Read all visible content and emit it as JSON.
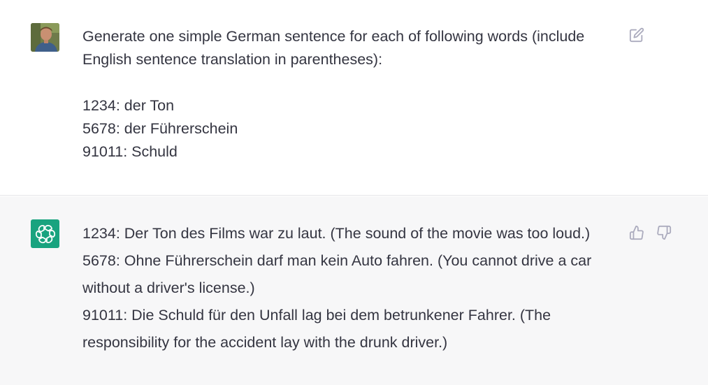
{
  "conversation": {
    "user_message": {
      "avatar_icon": "user-photo-avatar",
      "intro_lines": [
        "Generate one simple German sentence for each of following words (include",
        "English sentence translation in parentheses):"
      ],
      "word_lines": [
        "1234: der Ton",
        "5678: der Führerschein",
        "91011: Schuld"
      ],
      "edit_icon": "edit-icon"
    },
    "assistant_message": {
      "avatar_icon": "openai-logo-icon",
      "avatar_color": "#19a37f",
      "lines": [
        "1234: Der Ton des Films war zu laut. (The sound of the movie was too loud.)",
        "5678: Ohne Führerschein darf man kein Auto fahren. (You cannot drive a car",
        "without a driver's license.)",
        "91011: Die Schuld für den Unfall lag bei dem betrunkener Fahrer. (The",
        "responsibility for the accident lay with the drunk driver.)"
      ],
      "thumbs_up_icon": "thumbs-up-icon",
      "thumbs_down_icon": "thumbs-down-icon"
    }
  },
  "colors": {
    "user_bg": "#ffffff",
    "assistant_bg": "#f7f7f8",
    "text": "#343541",
    "icon": "#acacbe"
  }
}
